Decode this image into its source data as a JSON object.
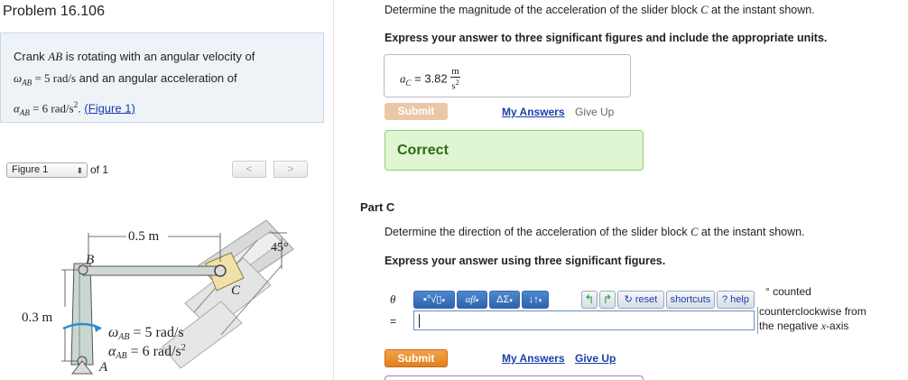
{
  "problem": {
    "title": "Problem 16.106",
    "statement_line1_prefix": "Crank ",
    "statement_line1_var": "AB",
    "statement_line1_suffix": " is rotating with an angular velocity of",
    "statement_line2_math": "ω",
    "statement_line2_sub": "AB",
    "statement_line2_value": " = 5 rad/s",
    "statement_line2_suffix": " and an angular acceleration of",
    "statement_line3_math": "α",
    "statement_line3_sub": "AB",
    "statement_line3_value": " = 6 rad/s",
    "statement_line3_sup": "2",
    "statement_line3_end": ". ",
    "figure_link": "(Figure 1)"
  },
  "figure_nav": {
    "selected": "Figure 1",
    "of_text": "of 1",
    "prev": "<",
    "next": ">"
  },
  "figure": {
    "dim_horizontal": "0.5 m",
    "dim_vertical": "0.3 m",
    "angle": "45°",
    "label_B": "B",
    "label_C": "C",
    "label_A": "A",
    "omega_label": "ω",
    "omega_sub": "AB",
    "omega_value": " = 5 rad/s",
    "alpha_label": "α",
    "alpha_sub": "AB",
    "alpha_value": " = 6 rad/s",
    "alpha_sup": "2",
    "arrow_color": "#2e8bd6"
  },
  "part_b": {
    "question_prefix": "Determine the magnitude of the acceleration of the slider block ",
    "question_var": "C",
    "question_suffix": " at the instant shown.",
    "instruction": "Express your answer to three significant figures and include the appropriate units.",
    "answer_var": "a",
    "answer_sub": "C",
    "answer_eq": " = ",
    "answer_value": "3.82",
    "unit_num": "m",
    "unit_den": "s",
    "unit_den_sup": "2",
    "submit": "Submit",
    "my_answers": "My Answers",
    "give_up": "Give Up",
    "correct": "Correct"
  },
  "part_c": {
    "heading": "Part C",
    "question_prefix": "Determine the direction of the acceleration of the slider block ",
    "question_var": "C",
    "question_suffix": " at the instant shown.",
    "instruction": "Express your answer using three significant figures.",
    "theta": "θ",
    "equals": "=",
    "toolbar": {
      "templates": "▪°√▯",
      "greek": "αβ",
      "symbols": "ΔΣ",
      "arrows": "↓↑",
      "undo": "↰",
      "redo": "↱",
      "reset": "↻ reset",
      "shortcuts": "shortcuts",
      "help": "? help"
    },
    "units_line1": "° counted",
    "units_line2": "counterclockwise from",
    "units_line3_prefix": "the negative ",
    "units_line3_var": "x",
    "units_line3_suffix": "-axis",
    "submit": "Submit",
    "my_answers": "My Answers",
    "give_up": "Give Up"
  },
  "colors": {
    "problem_box_bg": "#eef3f8",
    "correct_bg": "#dff5d3",
    "correct_text": "#2d6b17",
    "submit_orange": "#e68a2a",
    "link_blue": "#1a3fa8",
    "toolbar_blue": "#3e76c0"
  }
}
